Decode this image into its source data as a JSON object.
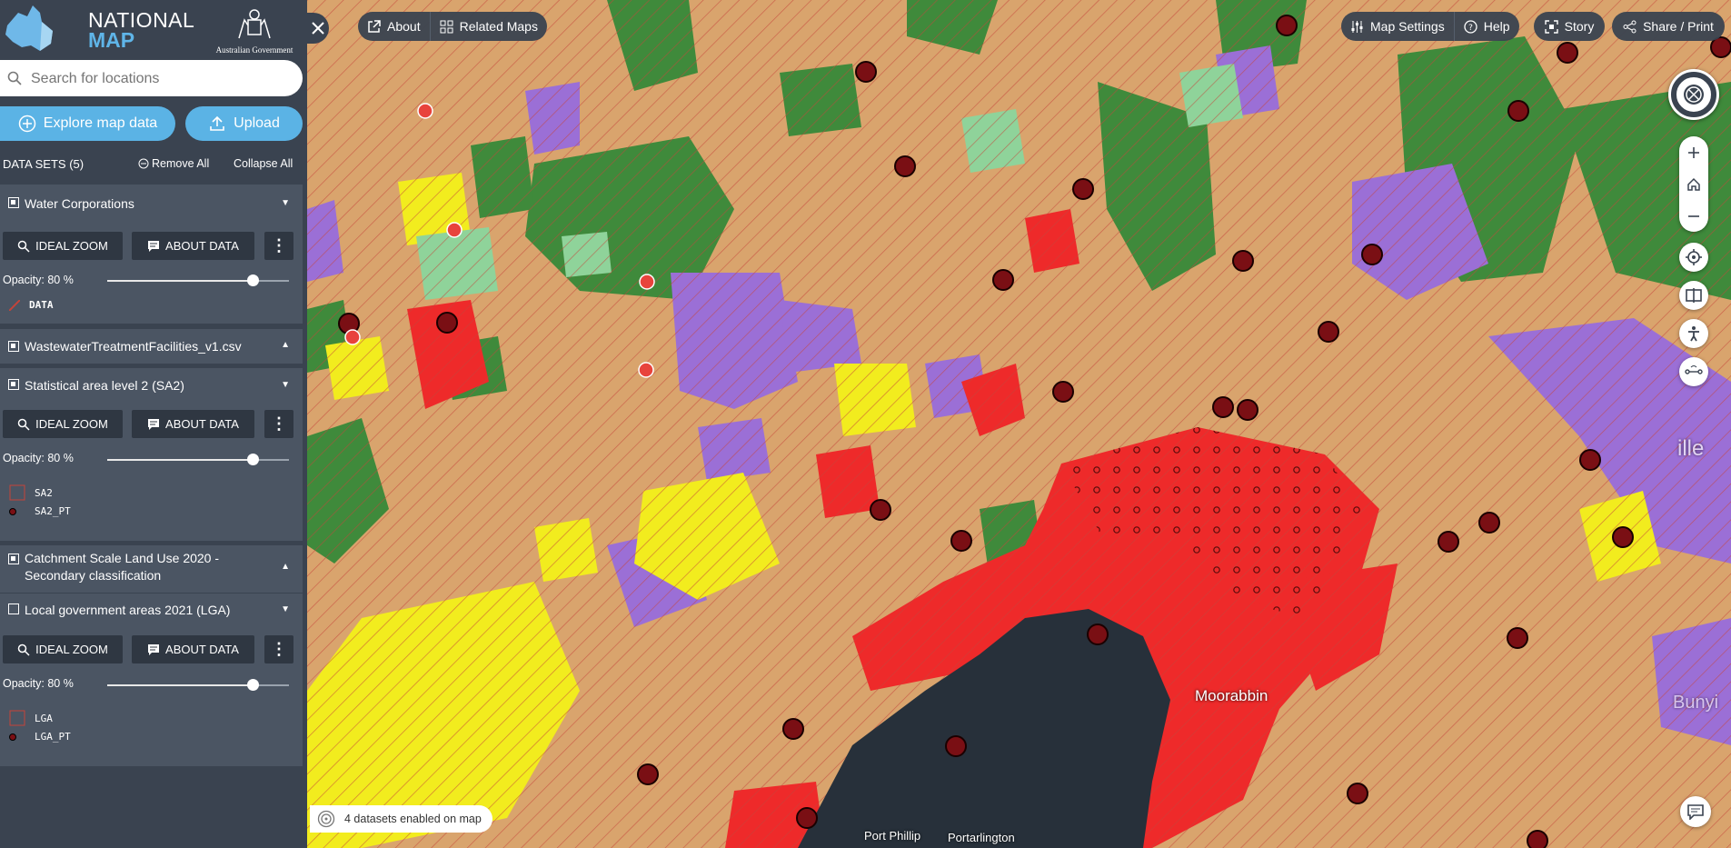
{
  "branding": {
    "title_line1": "NATIONAL",
    "title_line2": "MAP",
    "gov_text": "Australian Government"
  },
  "search": {
    "placeholder": "Search for locations"
  },
  "actions": {
    "explore_label": "Explore map data",
    "upload_label": "Upload"
  },
  "datasets": {
    "heading": "DATA SETS (5)",
    "remove_all": "Remove All",
    "collapse_all": "Collapse All",
    "ideal_zoom": "IDEAL ZOOM",
    "about_data": "ABOUT DATA",
    "items": [
      {
        "title": "Water Corporations",
        "opacity": "Opacity: 80 %",
        "opacity_value": 0.8,
        "legend": [
          "DATA"
        ]
      },
      {
        "title": "WastewaterTreatmentFacilities_v1.csv"
      },
      {
        "title": "Statistical area level 2 (SA2)",
        "opacity": "Opacity: 80 %",
        "opacity_value": 0.8,
        "legend": [
          "SA2",
          "SA2_PT"
        ]
      },
      {
        "title_line1": "Catchment Scale Land Use 2020 -",
        "title_line2": "Secondary classification"
      },
      {
        "title": "Local government areas 2021 (LGA)",
        "opacity": "Opacity: 80 %",
        "opacity_value": 0.8,
        "legend": [
          "LGA",
          "LGA_PT"
        ]
      }
    ]
  },
  "topbar": {
    "about": "About",
    "related_maps": "Related Maps",
    "map_settings": "Map Settings",
    "help": "Help",
    "story": "Story",
    "share": "Share / Print"
  },
  "status": {
    "text": "4 datasets enabled on map"
  },
  "map_labels": {
    "moorabbin": "Moorabbin",
    "port_phillip": "Port Phillip",
    "portarlington": "Portarlington",
    "ille": "ille",
    "bunyip": "Bunyi"
  },
  "colors": {
    "sidebar": "#3a4350",
    "accent": "#5bb3e5",
    "urban": "#ee2a2a",
    "forest": "#3f8a3b",
    "conservation": "#9b6fd6",
    "crops": "#f2ec1e",
    "grazing": "#d9a46d",
    "water": "#27303a",
    "marker": "#7a0f14"
  }
}
